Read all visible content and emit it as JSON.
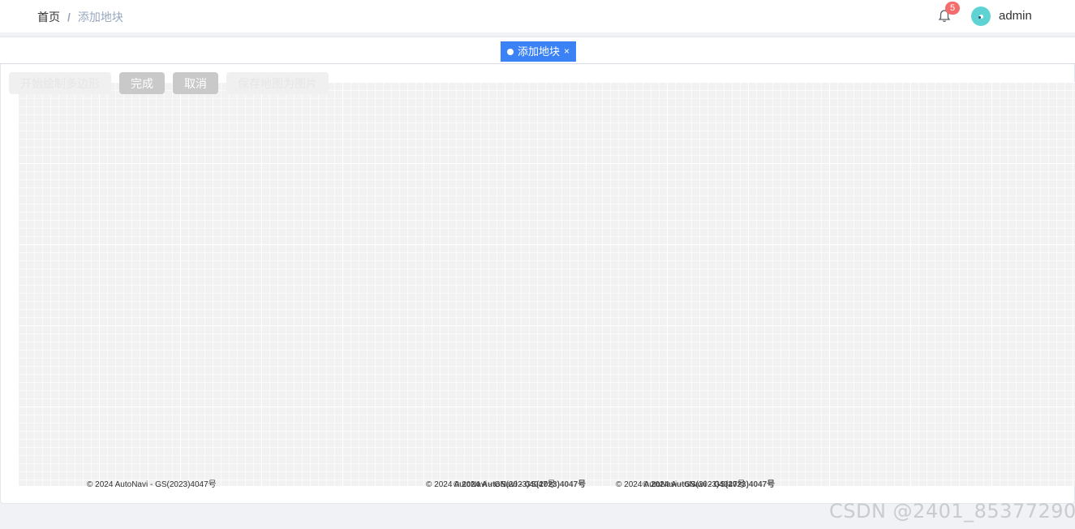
{
  "breadcrumb": {
    "home": "首页",
    "separator": "/",
    "current": "添加地块"
  },
  "header": {
    "notification_icon": "bell-icon",
    "notification_count": "5",
    "username": "admin",
    "avatar_icon": "avatar-icon"
  },
  "tags": [
    {
      "label": "添加地块",
      "close": "×",
      "active": true
    }
  ],
  "toolbar": {
    "start_draw": "开始绘制多边形",
    "finish": "完成",
    "cancel": "取消",
    "save_image": "保存地图为图片"
  },
  "map": {
    "copyright_1": "© 2024 AutoNavi - GS(2023)4047号",
    "copyright_2": "© 2024 AutoNavi - GS(2023)4047号",
    "copyright_2_overlap": "© 2024 AutoNavi - GS(2023)4047号",
    "copyright_3": "© 2024 AutoNavi - GS(2023)4047号",
    "copyright_3_overlap": "© 2024 AutoNavi - GS(2023)4047号"
  },
  "watermark": "CSDN @2401_85377290",
  "colors": {
    "accent": "#3b82f6",
    "badge": "#f56c6c",
    "avatar": "#5fd3d3"
  }
}
